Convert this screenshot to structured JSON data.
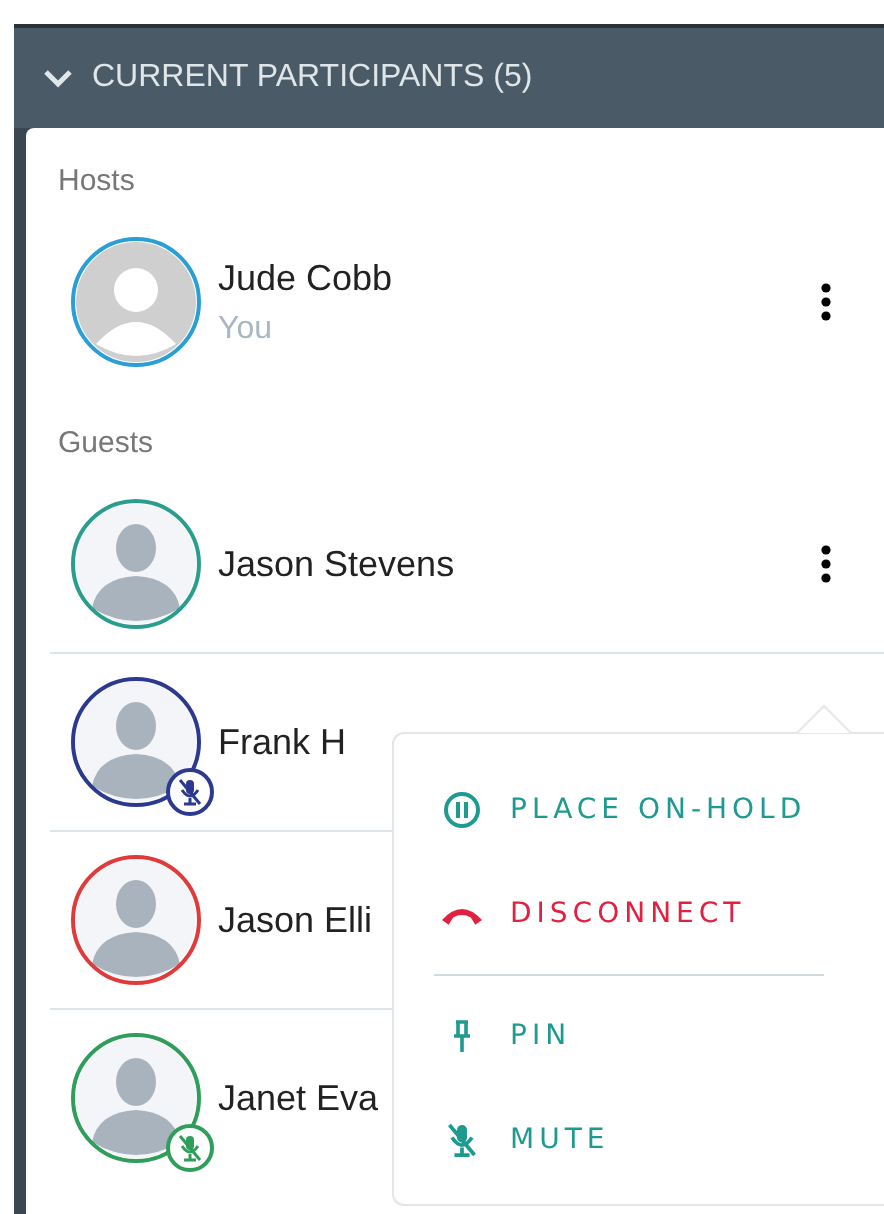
{
  "panel": {
    "title": "CURRENT PARTICIPANTS (5)",
    "expanded": true
  },
  "sections": [
    {
      "label": "Hosts",
      "participants": [
        {
          "name": "Jude Cobb",
          "subtitle": "You",
          "color": "#2a9fd6",
          "kind": "self",
          "muted": false,
          "has_menu": true
        }
      ]
    },
    {
      "label": "Guests",
      "participants": [
        {
          "name": "Jason Stevens",
          "color": "#2a9d8f",
          "kind": "guest",
          "muted": false,
          "has_menu": true
        },
        {
          "name": "Frank H",
          "color": "#2b3990",
          "kind": "guest",
          "muted": true,
          "has_menu": false
        },
        {
          "name": "Jason Elli",
          "color": "#e03a3a",
          "kind": "guest",
          "muted": false,
          "has_menu": false
        },
        {
          "name": "Janet Eva",
          "color": "#2e9e5a",
          "kind": "guest",
          "muted": true,
          "has_menu": false
        }
      ]
    }
  ],
  "menu": {
    "items": [
      {
        "label": "PLACE ON-HOLD",
        "kind": "hold"
      },
      {
        "label": "DISCONNECT",
        "kind": "disconnect"
      },
      {
        "kind": "divider"
      },
      {
        "label": "PIN",
        "kind": "pin"
      },
      {
        "label": "MUTE",
        "kind": "mute"
      }
    ]
  }
}
